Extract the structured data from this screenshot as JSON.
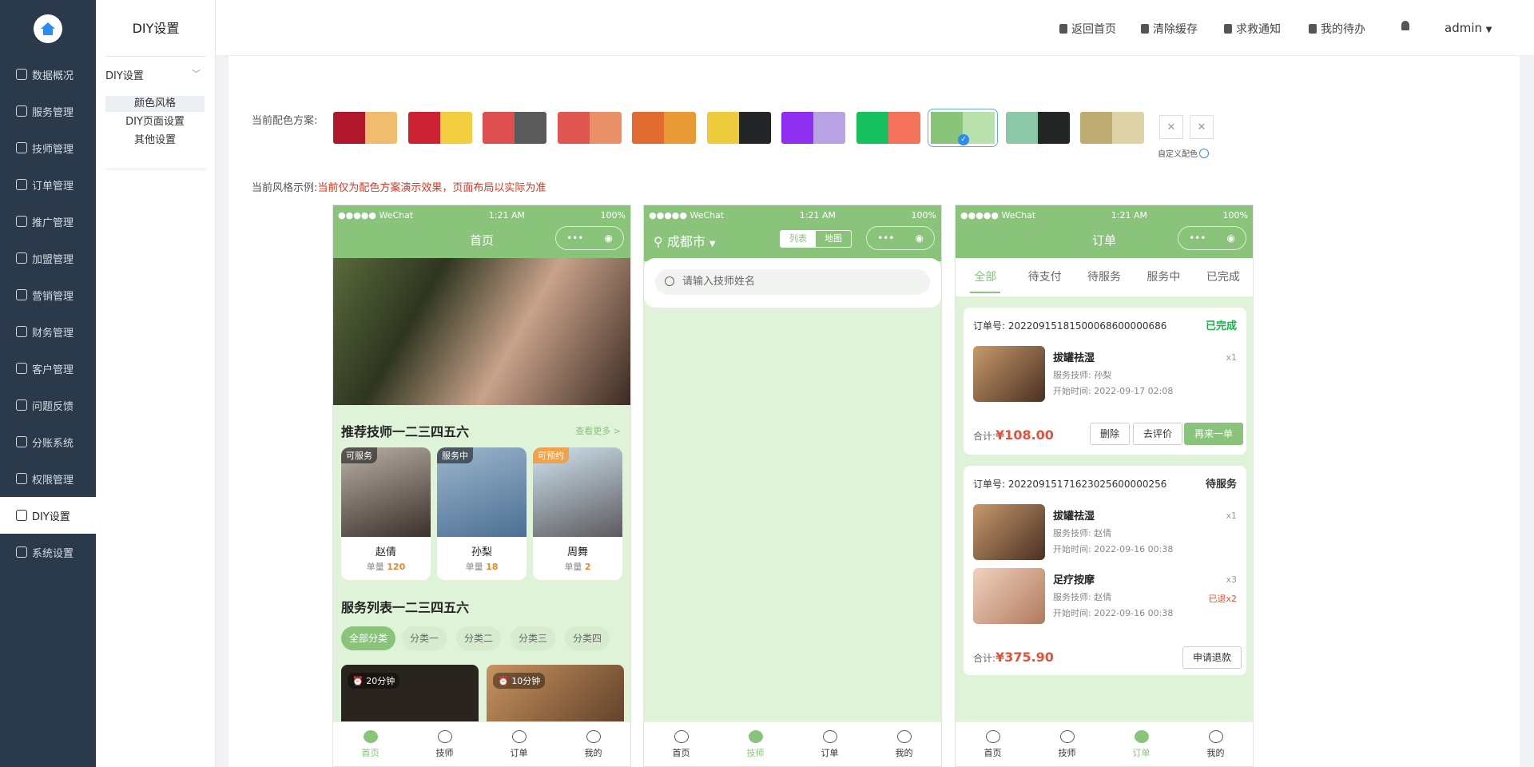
{
  "nav": {
    "items": [
      "数据概况",
      "服务管理",
      "技师管理",
      "订单管理",
      "推广管理",
      "加盟管理",
      "营销管理",
      "财务管理",
      "客户管理",
      "问题反馈",
      "分账系统",
      "权限管理",
      "DIY设置",
      "系统设置"
    ],
    "active_index": 12
  },
  "subnav": {
    "title": "DIY设置",
    "group": "DIY设置",
    "items": [
      "颜色风格",
      "DIY页面设置",
      "其他设置"
    ],
    "active_index": 0
  },
  "header": {
    "links": [
      "返回首页",
      "清除缓存",
      "求救通知",
      "我的待办"
    ],
    "user": "admin"
  },
  "scheme": {
    "label": "当前配色方案:",
    "swatches": [
      [
        "#b1172c",
        "#f0bd6e"
      ],
      [
        "#cc2234",
        "#f3cf3f"
      ],
      [
        "#e04f4f",
        "#5a5a5a"
      ],
      [
        "#e15553",
        "#e99067"
      ],
      [
        "#e16a31",
        "#e89b34"
      ],
      [
        "#eccc3c",
        "#232629"
      ],
      [
        "#8f30f0",
        "#b7a3e3"
      ],
      [
        "#17c05f",
        "#f4715a"
      ],
      [
        "#89c47a",
        "#b9e0ad"
      ],
      [
        "#8dc7aa",
        "#222625"
      ],
      [
        "#bfac72",
        "#ddd3a7"
      ]
    ],
    "selected_index": 8,
    "custom_label": "自定义配色"
  },
  "example": {
    "label": "当前风格示例:",
    "note": "当前仅为配色方案演示效果，页面布局以实际为准"
  },
  "phone_status": {
    "carrier": "●●●●● WeChat",
    "time": "1:21 AM",
    "battery": "100%"
  },
  "phone1": {
    "title": "首页",
    "rec_title": "推荐技师一二三四五六",
    "more": "查看更多 >",
    "techs": [
      {
        "tag": "可服务",
        "name": "赵倩",
        "count_label": "单量",
        "count": "120"
      },
      {
        "tag": "服务中",
        "name": "孙梨",
        "count_label": "单量",
        "count": "18"
      },
      {
        "tag": "可预约",
        "name": "周舞",
        "count_label": "单量",
        "count": "2"
      }
    ],
    "svc_title": "服务列表一二三四五六",
    "chips": [
      "全部分类",
      "分类一",
      "分类二",
      "分类三",
      "分类四"
    ],
    "services": [
      {
        "duration": "20分钟"
      },
      {
        "duration": "10分钟"
      }
    ]
  },
  "phone2": {
    "city": "成都市",
    "switch": [
      "列表",
      "地图"
    ],
    "search_placeholder": "请输入技师姓名"
  },
  "phone3": {
    "title": "订单",
    "tabs": [
      "全部",
      "待支付",
      "待服务",
      "服务中",
      "已完成"
    ],
    "orders": [
      {
        "no": "订单号: 20220915181500068600000686",
        "status": "已完成",
        "items": [
          {
            "name": "拔罐祛湿",
            "qty": "x1",
            "tech": "服务技师: 孙梨",
            "time": "开始时间: 2022-09-17 02:08"
          }
        ],
        "total_label": "合计:",
        "total": "¥108.00",
        "buttons": [
          "删除",
          "去评价",
          "再来一单"
        ]
      },
      {
        "no": "订单号: 20220915171623025600000256",
        "status": "待服务",
        "items": [
          {
            "name": "拔罐祛湿",
            "qty": "x1",
            "tech": "服务技师: 赵倩",
            "time": "开始时间: 2022-09-16 00:38"
          },
          {
            "name": "足疗按摩",
            "qty": "x3",
            "tech": "服务技师: 赵倩",
            "time": "开始时间: 2022-09-16 00:38",
            "refund": "已退x2"
          }
        ],
        "total_label": "合计:",
        "total": "¥375.90",
        "buttons": [
          "申请退款"
        ]
      }
    ]
  },
  "tabbar": [
    "首页",
    "技师",
    "订单",
    "我的"
  ]
}
